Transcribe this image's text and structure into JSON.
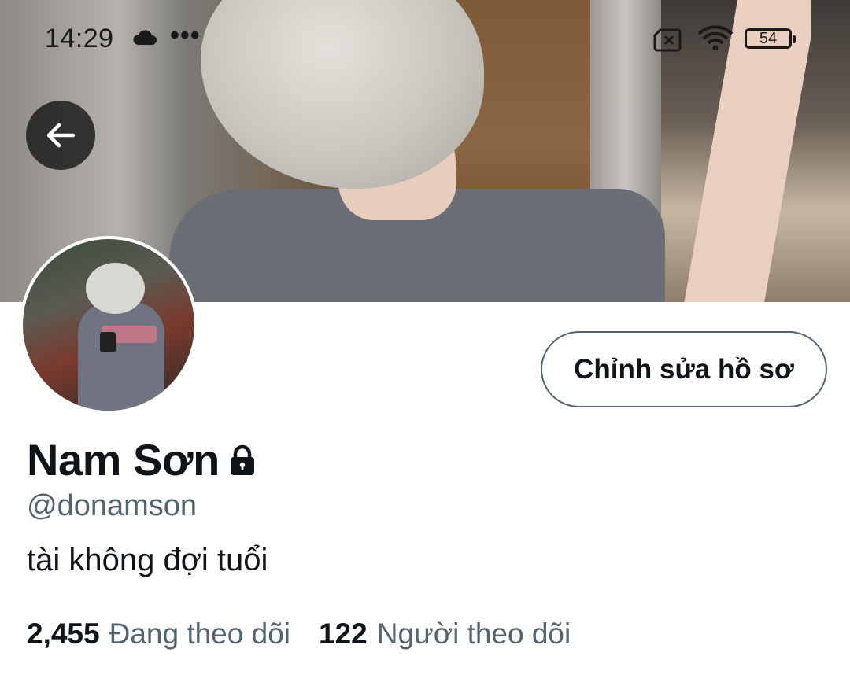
{
  "status_bar": {
    "time": "14:29",
    "cloud_icon": "cloud-icon",
    "more_icon": "more-dots-icon",
    "dots": "•••",
    "sim_icon": "no-sim-icon",
    "wifi_icon": "wifi-icon",
    "battery_level": "54"
  },
  "header": {
    "back_icon": "arrow-left-icon"
  },
  "profile": {
    "edit_button_label": "Chỉnh sửa hồ sơ",
    "display_name": "Nam Sơn",
    "protected_icon": "lock-icon",
    "handle": "@donamson",
    "bio": "tài không đợi tuổi",
    "following_count": "2,455",
    "following_label": "Đang theo dõi",
    "followers_count": "122",
    "followers_label": "Người theo dõi"
  },
  "colors": {
    "primary_text": "#0f1419",
    "secondary_text": "#536471",
    "button_border": "#536471",
    "back_button_bg": "#191919"
  }
}
